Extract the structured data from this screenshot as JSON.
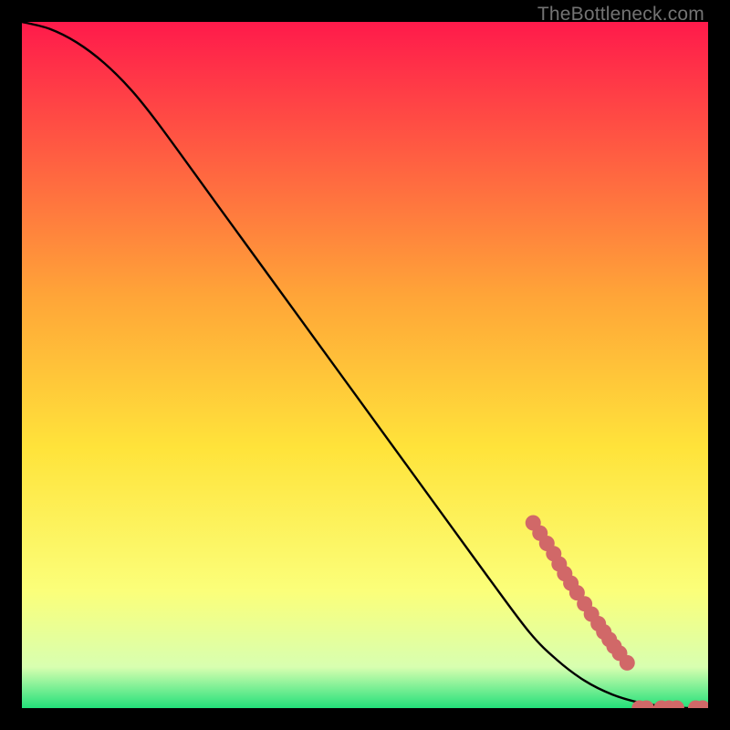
{
  "watermark": "TheBottleneck.com",
  "colors": {
    "gradient_top": "#ff1a4b",
    "gradient_mid1": "#ffa538",
    "gradient_mid2": "#ffe33a",
    "gradient_mid3": "#fbff7a",
    "gradient_mid4": "#d8ffb0",
    "gradient_bottom": "#23e07a",
    "curve": "#000000",
    "dot": "#d16868",
    "frame": "#000000"
  },
  "chart_data": {
    "type": "line",
    "title": "",
    "xlabel": "",
    "ylabel": "",
    "xlim": [
      0,
      100
    ],
    "ylim": [
      0,
      100
    ],
    "curve": {
      "x": [
        0,
        4,
        8,
        12,
        16,
        20,
        28,
        36,
        44,
        52,
        60,
        68,
        74,
        78,
        82,
        86,
        90,
        94,
        97,
        100
      ],
      "y": [
        100,
        99,
        97,
        94,
        90,
        85,
        74,
        63,
        52,
        41,
        30,
        19,
        11,
        7,
        4,
        2,
        0.8,
        0.2,
        0,
        0
      ]
    },
    "dots_on_curve": {
      "x": [
        74.5,
        75.5,
        76.5,
        77.5,
        78.3,
        79.1,
        80.0,
        80.9,
        82.0,
        83.0,
        84.0,
        84.8,
        85.6,
        86.3,
        87.1,
        88.2
      ],
      "y": [
        27.0,
        25.5,
        24.0,
        22.5,
        21.0,
        19.6,
        18.2,
        16.8,
        15.2,
        13.7,
        12.3,
        11.1,
        10.0,
        9.0,
        8.0,
        6.6
      ]
    },
    "dots_baseline": {
      "x": [
        90.0,
        91.0,
        93.2,
        94.3,
        95.4,
        98.2,
        99.2
      ],
      "y": [
        0,
        0,
        0,
        0,
        0,
        0,
        0
      ]
    }
  }
}
